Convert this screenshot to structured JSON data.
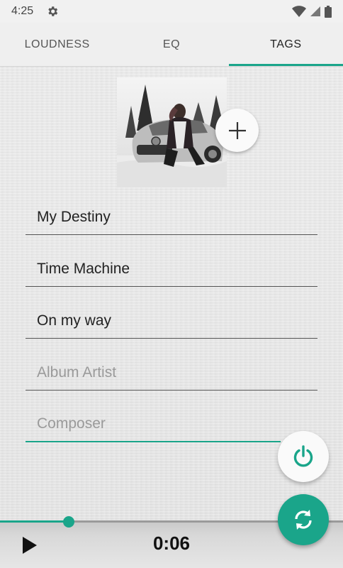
{
  "status_bar": {
    "time": "4:25",
    "icons": [
      "settings-gear-icon",
      "wifi-icon",
      "cell-signal-icon",
      "battery-icon"
    ]
  },
  "tabs": [
    {
      "label": "LOUDNESS",
      "active": false
    },
    {
      "label": "EQ",
      "active": false
    },
    {
      "label": "TAGS",
      "active": true
    }
  ],
  "tags": {
    "title": "My Destiny",
    "artist": "Time Machine",
    "album": "On my way",
    "album_artist_placeholder": "Album Artist",
    "composer_placeholder": "Composer"
  },
  "player": {
    "time": "0:06",
    "progress": 0.2
  },
  "colors": {
    "accent": "#1aa58a",
    "background": "#e9e9e9"
  }
}
